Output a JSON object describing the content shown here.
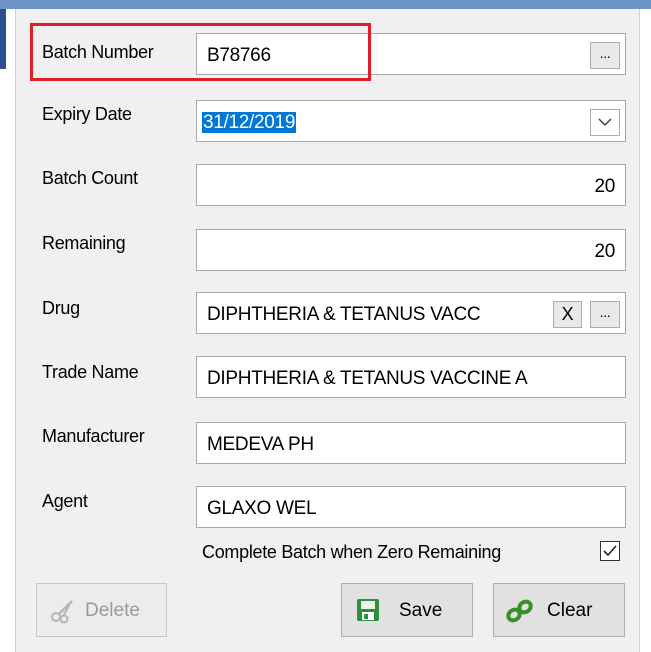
{
  "form": {
    "batch_number": {
      "label": "Batch Number",
      "value": "B78766",
      "browse_label": "..."
    },
    "expiry_date": {
      "label": "Expiry Date",
      "value": "31/12/2019"
    },
    "batch_count": {
      "label": "Batch Count",
      "value": "20"
    },
    "remaining": {
      "label": "Remaining",
      "value": "20"
    },
    "drug": {
      "label": "Drug",
      "value": "DIPHTHERIA & TETANUS VACC",
      "clear_label": "X",
      "browse_label": "..."
    },
    "trade_name": {
      "label": "Trade Name",
      "value": "DIPHTHERIA & TETANUS VACCINE A"
    },
    "manufacturer": {
      "label": "Manufacturer",
      "value": "MEDEVA PH"
    },
    "agent": {
      "label": "Agent",
      "value": "GLAXO WEL"
    },
    "complete_batch": {
      "label": "Complete Batch when Zero Remaining",
      "checked": true
    }
  },
  "buttons": {
    "delete_label": "Delete",
    "save_label": "Save",
    "clear_label": "Clear"
  },
  "icons": {
    "delete": "scissors-icon",
    "save": "floppy-disk-icon",
    "clear": "broken-chain-icon",
    "dropdown": "chevron-down-icon",
    "checkbox": "checkmark-icon"
  },
  "colors": {
    "highlight": "#e11d2a",
    "selection": "#0078d7",
    "panel": "#f0f0f0",
    "title_bar": "#6f93c6"
  }
}
